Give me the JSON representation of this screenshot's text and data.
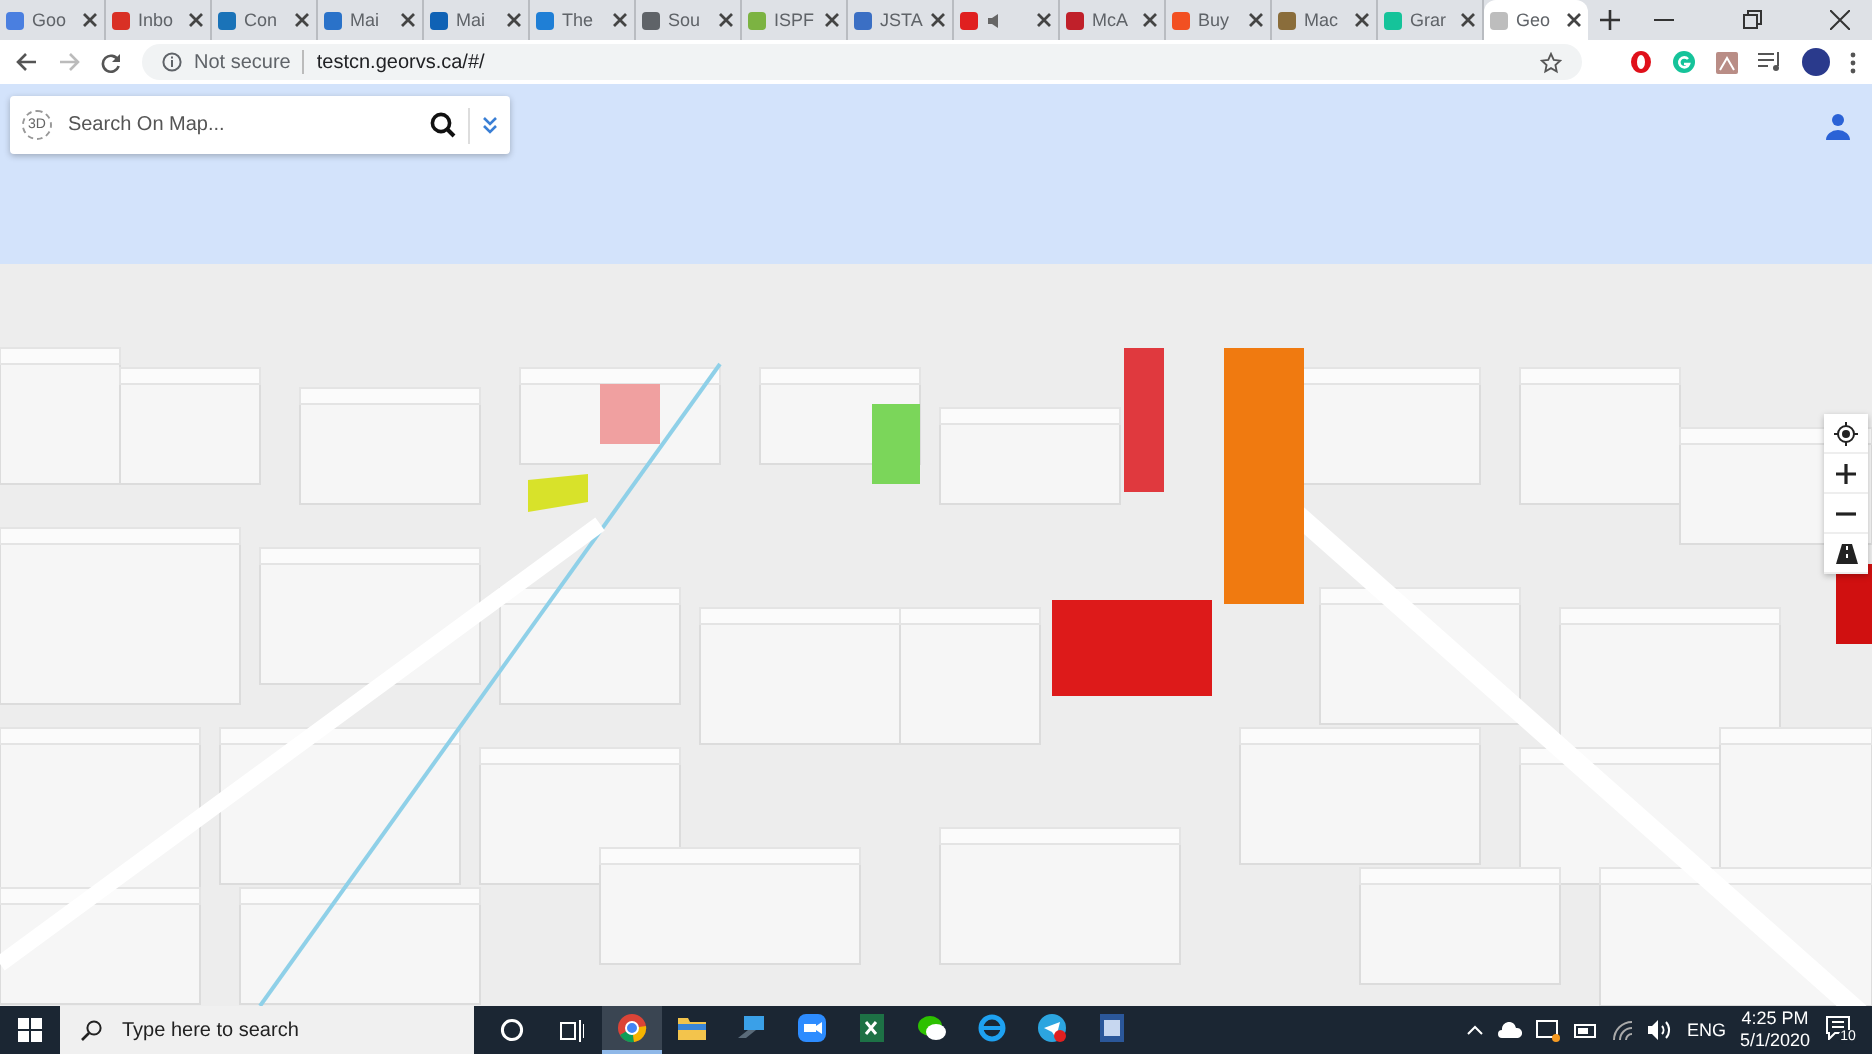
{
  "browser": {
    "tabs": [
      {
        "label": "Goo",
        "color": "#4a7fe0",
        "selected": false
      },
      {
        "label": "Inbo",
        "color": "#d93025",
        "selected": false
      },
      {
        "label": "Con",
        "color": "#1a73b8",
        "selected": false
      },
      {
        "label": "Mai",
        "color": "#2a72c9",
        "selected": false
      },
      {
        "label": "Mai",
        "color": "#0f62b5",
        "selected": false
      },
      {
        "label": "The",
        "color": "#1f7fd6",
        "selected": false
      },
      {
        "label": "Sou",
        "color": "#5f6368",
        "selected": false
      },
      {
        "label": "ISPF",
        "color": "#7cb342",
        "selected": false
      },
      {
        "label": "JSTA",
        "color": "#3b6fc4",
        "selected": false
      },
      {
        "color": "#e02020",
        "selected": false
      },
      {
        "label": "McA",
        "color": "#c0202a",
        "selected": false
      },
      {
        "label": "Buy",
        "color": "#f25022",
        "selected": false
      },
      {
        "label": "Mac",
        "color": "#8a6d3b",
        "selected": false
      },
      {
        "label": "Grar",
        "color": "#15c39a",
        "selected": false
      },
      {
        "label": "Geo",
        "color": "#bdbdbd",
        "selected": true
      }
    ],
    "address_bar": {
      "security": "Not secure",
      "url": "testcn.georvs.ca/#/"
    }
  },
  "map": {
    "search": {
      "mode_badge": "3D",
      "placeholder": "Search On Map..."
    }
  },
  "taskbar": {
    "search_placeholder": "Type here to search",
    "apps": [
      {
        "kind": "chrome",
        "selected": true
      },
      {
        "kind": "folder",
        "selected": false
      },
      {
        "kind": "remote",
        "selected": false
      },
      {
        "kind": "zoom",
        "selected": false
      },
      {
        "kind": "excel",
        "selected": false
      },
      {
        "kind": "wechat",
        "selected": false
      },
      {
        "kind": "ie",
        "selected": false
      },
      {
        "kind": "telegram",
        "selected": false
      },
      {
        "kind": "word",
        "selected": false
      }
    ],
    "tray": {
      "language": "ENG",
      "time": "4:25 PM",
      "date": "5/1/2020",
      "notifications": "10"
    }
  }
}
